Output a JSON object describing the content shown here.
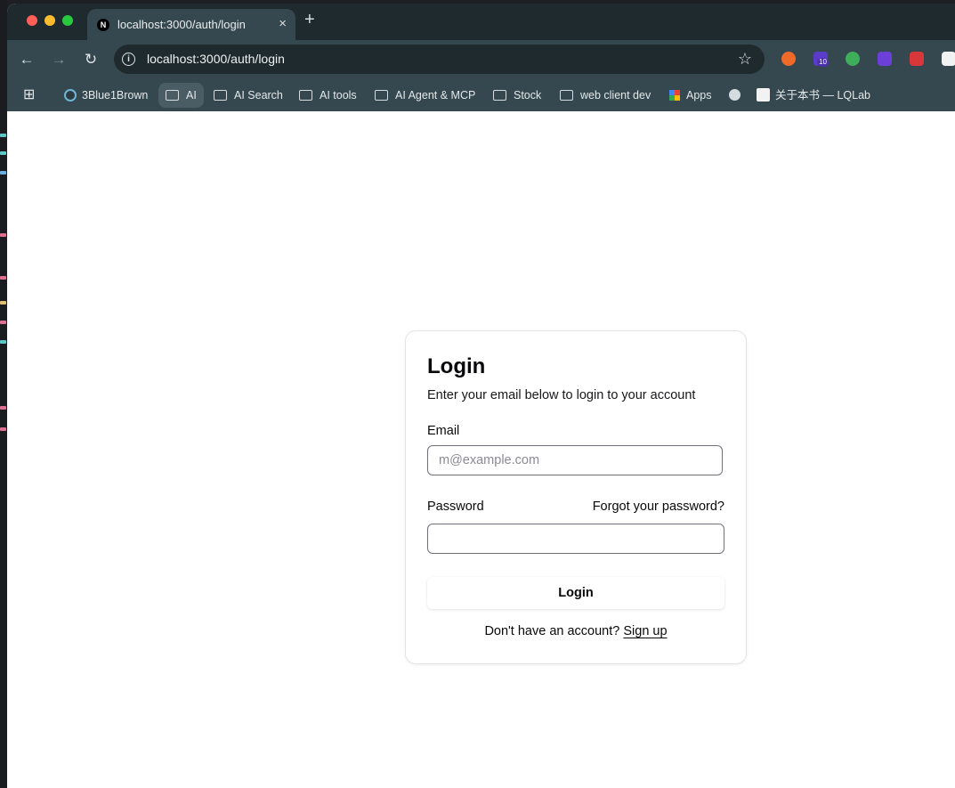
{
  "browser": {
    "tab_title": "localhost:3000/auth/login",
    "tab_favicon": "N",
    "new_tab": "+",
    "tab_close": "×",
    "url": "localhost:3000/auth/login",
    "ext_badge": "10"
  },
  "bookmarks": [
    {
      "label": "3Blue1Brown",
      "icon": "3b1b-icon"
    },
    {
      "label": "AI",
      "icon": "folder-icon"
    },
    {
      "label": "AI Search",
      "icon": "folder-icon"
    },
    {
      "label": "AI tools",
      "icon": "folder-icon"
    },
    {
      "label": "AI Agent & MCP",
      "icon": "folder-icon"
    },
    {
      "label": "Stock",
      "icon": "folder-icon"
    },
    {
      "label": "web client dev",
      "icon": "folder-icon"
    },
    {
      "label": "Apps",
      "icon": "apps-grid-icon"
    },
    {
      "label": "关于本书 — LQLab",
      "icon": "book-favicon"
    }
  ],
  "login": {
    "title": "Login",
    "description": "Enter your email below to login to your account",
    "email_label": "Email",
    "email_placeholder": "m@example.com",
    "password_label": "Password",
    "forgot_link": "Forgot your password?",
    "submit_label": "Login",
    "signup_prompt": "Don't have an account?",
    "signup_link": "Sign up"
  },
  "colors": {
    "chrome_bg": "#36484f",
    "titlebar_bg": "#1f2a2e",
    "close_dot": "#ff5f57",
    "minimize_dot": "#febc2e",
    "zoom_dot": "#28c840"
  }
}
